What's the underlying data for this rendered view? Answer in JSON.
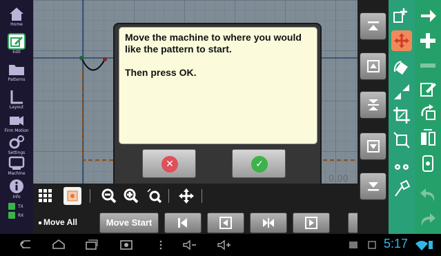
{
  "sidebar": {
    "items": [
      {
        "label": "Home",
        "icon": "home-icon"
      },
      {
        "label": "Edit",
        "icon": "edit-icon"
      },
      {
        "label": "Patterns",
        "icon": "folder-icon"
      },
      {
        "label": "Layout",
        "icon": "layout-icon"
      },
      {
        "label": "Firm Motion",
        "icon": "camera-icon"
      },
      {
        "label": "Settings",
        "icon": "gears-icon"
      },
      {
        "label": "Machine",
        "icon": "machine-icon"
      },
      {
        "label": "Info",
        "icon": "info-icon"
      }
    ],
    "indicators": [
      {
        "label": "TX"
      },
      {
        "label": "RX"
      }
    ]
  },
  "canvas": {
    "readout": "0.00"
  },
  "dialog": {
    "line1": "Move the machine to where you would like the pattern to start.",
    "line2": "Then press OK.",
    "cancel_icon": "cancel-x-icon",
    "ok_icon": "check-icon"
  },
  "toolbar": {
    "move_all_label": "Move All",
    "move_start_label": "Move Start",
    "icons": [
      "grid-icon",
      "quilt-pattern-icon",
      "zoom-out-icon",
      "zoom-in-icon",
      "zoom-fit-icon",
      "pan-icon"
    ]
  },
  "colors": {
    "accent_green": "#2aa078",
    "dialog_bg": "#fbfbdc",
    "clock_blue": "#33b5e5",
    "pattern_line": "#e07b20"
  },
  "status": {
    "clock": "5:17"
  }
}
